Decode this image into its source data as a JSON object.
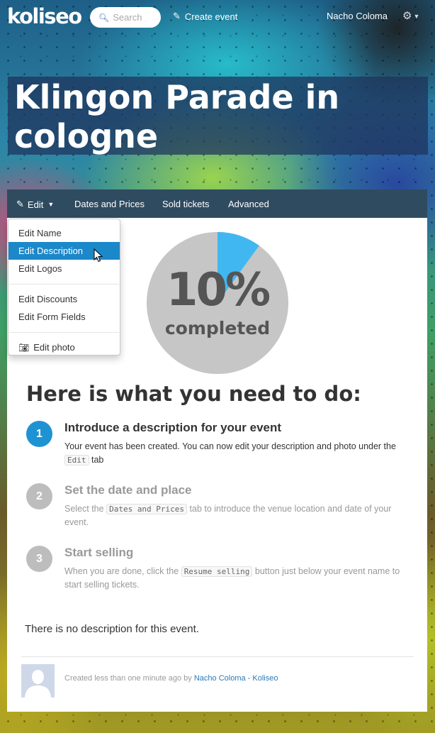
{
  "nav": {
    "logo": "koliseo",
    "search_placeholder": "Search",
    "create_event": "Create event",
    "user_name": "Nacho Coloma"
  },
  "event": {
    "title": "Klingon Parade in cologne"
  },
  "tabs": {
    "edit": "Edit",
    "dates": "Dates and Prices",
    "sold": "Sold tickets",
    "advanced": "Advanced"
  },
  "edit_menu": {
    "items": [
      "Edit Name",
      "Edit Description",
      "Edit Logos",
      "Edit Discounts",
      "Edit Form Fields",
      "Edit photo"
    ],
    "active_index": 1
  },
  "progress": {
    "percent": 10,
    "percent_label": "10%",
    "label": "completed",
    "fill_color": "#40b7f0",
    "track_color": "#c6c6c6"
  },
  "todo": {
    "heading": "Here is what you need to do:",
    "steps": [
      {
        "number": "1",
        "title": "Introduce a description for your event",
        "desc_before": "Your event has been created. You can now edit your description and photo under the",
        "code": "Edit",
        "desc_after": "tab"
      },
      {
        "number": "2",
        "title": "Set the date and place",
        "desc_before": "Select the",
        "code": "Dates and Prices",
        "desc_after": "tab to introduce the venue location and date of your event."
      },
      {
        "number": "3",
        "title": "Start selling",
        "desc_before": "When you are done, click the",
        "code": "Resume selling",
        "desc_after": "button just below your event name to start selling tickets."
      }
    ]
  },
  "description": {
    "empty_text": "There is no description for this event."
  },
  "footer": {
    "created_text": "Created less than one minute ago by",
    "author_link": "Nacho Coloma - Koliseo"
  },
  "colors": {
    "accent": "#1d93d3",
    "tabbar": "#2f4b60",
    "menu_active": "#1b88c9"
  }
}
